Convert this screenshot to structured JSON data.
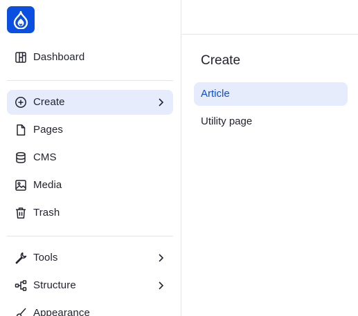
{
  "sidebar": {
    "logo_icon": "drupal-drop-icon",
    "top_items": [
      {
        "label": "Dashboard",
        "icon": "dashboard-icon"
      }
    ],
    "main_items": [
      {
        "label": "Create",
        "icon": "plus-circle-icon",
        "active": true,
        "has_submenu": true
      },
      {
        "label": "Pages",
        "icon": "page-icon"
      },
      {
        "label": "CMS",
        "icon": "database-icon"
      },
      {
        "label": "Media",
        "icon": "image-icon"
      },
      {
        "label": "Trash",
        "icon": "trash-icon"
      }
    ],
    "bottom_items": [
      {
        "label": "Tools",
        "icon": "wrench-icon",
        "has_submenu": true
      },
      {
        "label": "Structure",
        "icon": "structure-icon",
        "has_submenu": true
      },
      {
        "label": "Appearance",
        "icon": "brush-icon"
      }
    ]
  },
  "submenu": {
    "title": "Create",
    "items": [
      {
        "label": "Article",
        "active": true
      },
      {
        "label": "Utility page"
      }
    ]
  },
  "colors": {
    "brand": "#0a4fe0",
    "active_bg": "#e6ecfb",
    "active_text": "#0a4fd1",
    "divider": "#e3e4ea"
  }
}
